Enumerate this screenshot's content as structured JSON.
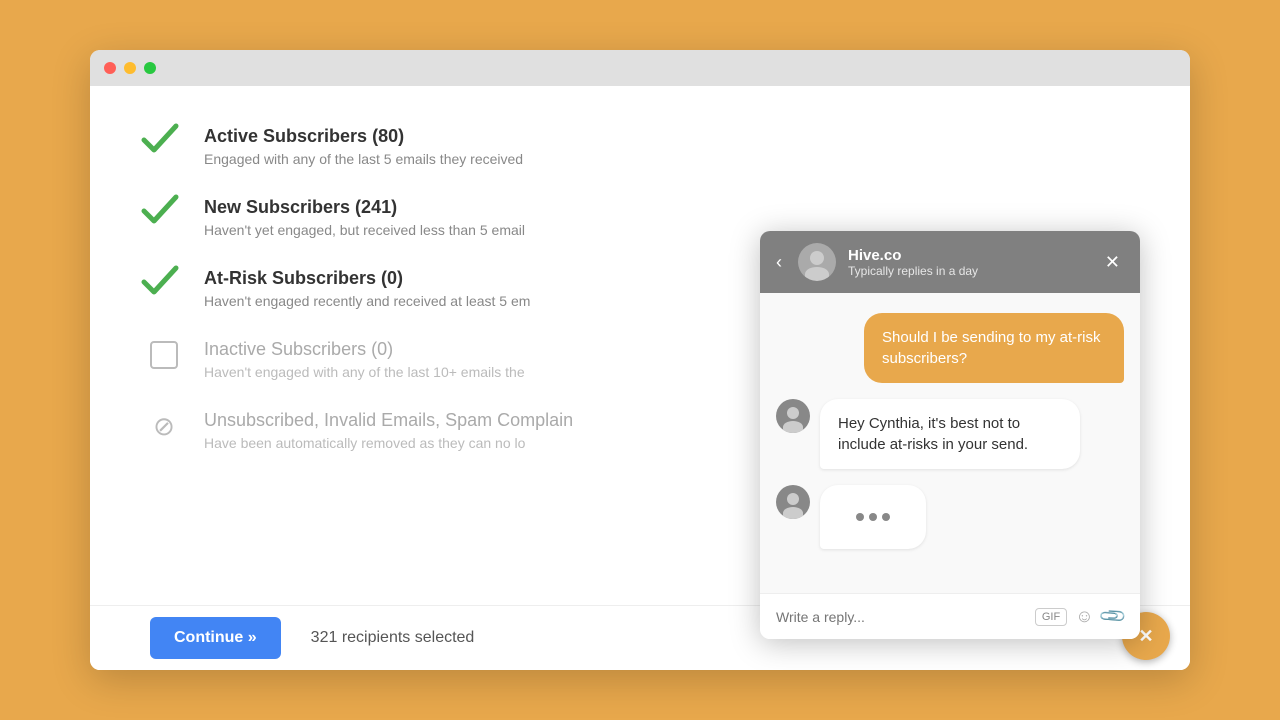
{
  "browser": {
    "dots": [
      "red",
      "yellow",
      "green"
    ]
  },
  "subscribers": [
    {
      "id": "active",
      "title": "Active Subscribers (80)",
      "description": "Engaged with any of the last 5 emails they received",
      "state": "checked",
      "dimmed": false
    },
    {
      "id": "new",
      "title": "New Subscribers (241)",
      "description": "Haven't yet engaged, but received less than 5 email",
      "state": "checked",
      "dimmed": false
    },
    {
      "id": "at-risk",
      "title": "At-Risk Subscribers (0)",
      "description": "Haven't engaged recently and received at least 5 em",
      "state": "checked",
      "dimmed": false
    },
    {
      "id": "inactive",
      "title": "Inactive Subscribers (0)",
      "description": "Haven't engaged with any of the last 10+ emails the",
      "state": "unchecked",
      "dimmed": true
    },
    {
      "id": "unsubscribed",
      "title": "Unsubscribed, Invalid Emails, Spam Complain",
      "description": "Have been automatically removed as they can no lo",
      "state": "blocked",
      "dimmed": true
    }
  ],
  "footer": {
    "continue_label": "Continue »",
    "recipients_text": "321 recipients selected"
  },
  "chat": {
    "header": {
      "name": "Hive.co",
      "status": "Typically replies in a day"
    },
    "messages": [
      {
        "side": "right",
        "text": "Should I be sending to my at-risk subscribers?"
      },
      {
        "side": "left",
        "text": "Hey Cynthia, it's best not to include at-risks in your send."
      },
      {
        "side": "left",
        "text": "..."
      }
    ],
    "input_placeholder": "Write a reply...",
    "gif_label": "GIF"
  }
}
